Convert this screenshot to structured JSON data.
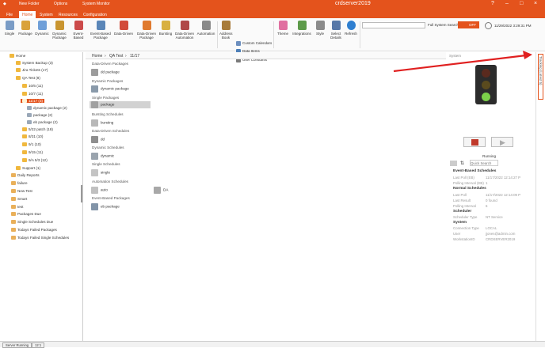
{
  "titlebar": {
    "quick_access": [
      "New Folder",
      "Options",
      "System Monitor"
    ],
    "title": "crdserver2019",
    "accent": "#e4531c"
  },
  "tabs": [
    "File",
    "Home",
    "System",
    "Resources",
    "Configuration"
  ],
  "ribbon": {
    "buttons": [
      "Single",
      "Package",
      "Dynamic",
      "Dynamic Package",
      "Event-Based",
      "Event-Based Package",
      "Data-Driven",
      "Data-Driven Package",
      "Bursting",
      "Data-Driven Automation",
      "Automation",
      "Address Book"
    ],
    "small": [
      "Custom Calendars",
      "Data Items",
      "User Constants"
    ],
    "right_buttons": [
      "Theme",
      "Integrations",
      "Style",
      "Select Details",
      "Refresh"
    ],
    "search_label": "Full System Search",
    "off_label": "OFF",
    "datetime": "11/29/2022 3:29:31 PM"
  },
  "tree": {
    "home": "Home",
    "items": [
      {
        "label": "System Backup (3)"
      },
      {
        "label": "Jira Tickets (17)"
      },
      {
        "label": "QA Test (8)"
      },
      {
        "label": "10/6 (11)"
      },
      {
        "label": "10/7 (11)"
      },
      {
        "label": "11/17 (3)",
        "selected": true
      },
      {
        "label": "dynamic package (2)"
      },
      {
        "label": "package (2)"
      },
      {
        "label": "eb package (2)"
      },
      {
        "label": "5/22 patch (18)"
      },
      {
        "label": "8/31 (10)"
      },
      {
        "label": "9/1 (10)"
      },
      {
        "label": "9/15 (11)"
      },
      {
        "label": "9/A 5/3 (12)"
      },
      {
        "label": "Support (1)"
      }
    ],
    "smart": [
      "Daily Reports",
      "failure",
      "New Test",
      "Smart",
      "test",
      "Packages Due",
      "Single Schedules Due",
      "Todays Failed Packages",
      "Todays Failed Single Schedules"
    ]
  },
  "breadcrumb": [
    "Home",
    "QA Test",
    "11/17"
  ],
  "sections": [
    {
      "title": "Data-Driven Packages",
      "items": [
        "dd package"
      ]
    },
    {
      "title": "Dynamic Packages",
      "items": [
        "dynamic package"
      ]
    },
    {
      "title": "Single Packages",
      "items": [
        "package"
      ]
    },
    {
      "title": "Bursting Schedules",
      "items": [
        "bursting"
      ]
    },
    {
      "title": "Data-Driven Schedules",
      "items": [
        "dd"
      ]
    },
    {
      "title": "Dynamic Schedules",
      "items": [
        "dynamic"
      ]
    },
    {
      "title": "Single Schedules",
      "items": [
        "single"
      ]
    },
    {
      "title": "Automation Schedules",
      "items": [
        "auto",
        "DA"
      ]
    },
    {
      "title": "Event-Based Packages",
      "items": [
        "eb package"
      ]
    }
  ],
  "right": {
    "header": "System",
    "status": "Running",
    "quick_search": "Quick Search",
    "side_tab": "Tracking (Latest 5)",
    "groups": [
      {
        "title": "Event-Based Schedules",
        "rows": [
          [
            "Last Poll (EB)",
            "11/17/2022 12:14:27 P"
          ],
          [
            "Polling Interval (EB)",
            "1"
          ]
        ]
      },
      {
        "title": "Normal Schedules",
        "rows": [
          [
            "Last Poll",
            "11/17/2022 12:14:09 P"
          ],
          [
            "Last Result",
            "0 found"
          ],
          [
            "Polling Interval",
            "6"
          ]
        ]
      },
      {
        "title": "Scheduler",
        "rows": [
          [
            "Scheduler Type",
            "NT Service"
          ]
        ]
      },
      {
        "title": "System",
        "rows": [
          [
            "Connection Type",
            "LOCAL"
          ],
          [
            "User",
            "jjones@admin.com"
          ],
          [
            "WorkstationID",
            "CRDSERVER2019"
          ]
        ]
      }
    ]
  },
  "statusbar": [
    "Server Running",
    "12:1"
  ]
}
